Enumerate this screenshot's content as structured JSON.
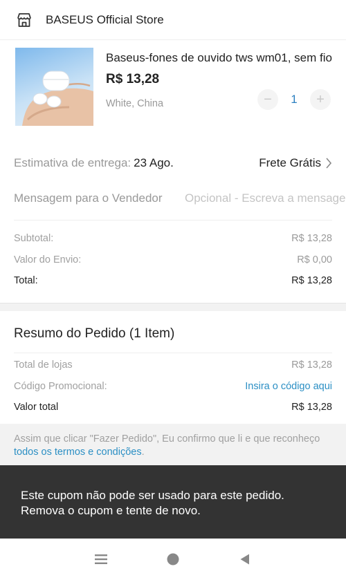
{
  "store": {
    "name": "BASEUS Official Store",
    "icon": "store-icon"
  },
  "product": {
    "title": "Baseus-fones de ouvido tws wm01, sem fio",
    "price": "R$ 13,28",
    "variant": "White, China",
    "quantity": "1",
    "decrement_label": "−",
    "increment_label": "+"
  },
  "delivery": {
    "label": "Estimativa de entrega:",
    "date": "23 Ago.",
    "shipping": "Frete Grátis"
  },
  "message": {
    "label": "Mensagem para o Vendedor",
    "placeholder": "Opcional - Escreva a mensagem",
    "value": ""
  },
  "totals": {
    "subtotal_label": "Subtotal:",
    "subtotal": "R$ 13,28",
    "shipping_label": "Valor do Envio:",
    "shipping": "R$ 0,00",
    "total_label": "Total:",
    "total": "R$ 13,28"
  },
  "summary": {
    "title": "Resumo do Pedido (1 Item)",
    "stores_label": "Total de lojas",
    "stores_value": "R$ 13,28",
    "promo_label": "Código Promocional:",
    "promo_link": "Insira o código aqui",
    "grand_label": "Valor total",
    "grand_value": "R$ 13,28"
  },
  "terms": {
    "text": "Assim que clicar \"Fazer Pedido\", Eu confirmo que li e que reconheço ",
    "link": "todos os termos e condições",
    "suffix": "."
  },
  "toast": {
    "line1": "Este cupom não pode ser usado para este pedido.",
    "line2": "Remova o cupom e tente de novo."
  },
  "navbar": {
    "icons": [
      "menu-icon",
      "home-icon",
      "back-icon"
    ]
  },
  "colors": {
    "accent_blue": "#2b8fc4",
    "toast_bg": "#333333"
  }
}
